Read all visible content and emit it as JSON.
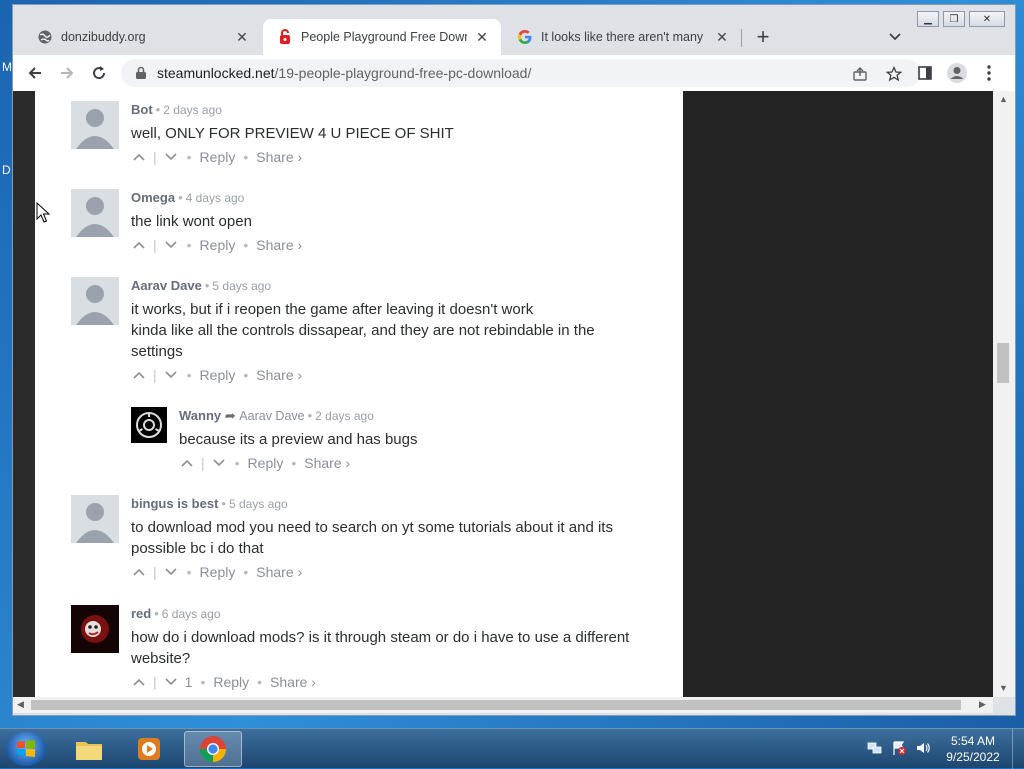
{
  "desktop": {
    "letters": [
      "M",
      "D"
    ]
  },
  "browser": {
    "tabs": [
      {
        "title": "donzibuddy.org",
        "icon": "globe-icon",
        "active": false
      },
      {
        "title": "People Playground Free Download",
        "icon": "steamunlocked-icon",
        "active": true
      },
      {
        "title": "It looks like there aren't many great matches",
        "icon": "google-icon",
        "active": false
      }
    ],
    "address": {
      "host": "steamunlocked.net",
      "path": "/19-people-playground-free-pc-download/"
    },
    "window_controls": [
      "minimize",
      "restore",
      "close"
    ]
  },
  "comments": {
    "action_labels": {
      "reply": "Reply",
      "share": "Share ›"
    },
    "items": [
      {
        "author": "Bot",
        "time": "2 days ago",
        "lines": [
          "well, ONLY FOR PREVIEW 4 U PIECE OF SHIT"
        ],
        "votes": ""
      },
      {
        "author": "Omega",
        "time": "4 days ago",
        "lines": [
          "the link wont open"
        ],
        "votes": ""
      },
      {
        "author": "Aarav Dave",
        "time": "5 days ago",
        "lines": [
          "it works, but if i reopen the game after leaving it doesn't work",
          "kinda like all the controls dissapear, and they are not rebindable in the settings"
        ],
        "votes": ""
      },
      {
        "author": "Wanny",
        "in_reply_to": "Aarav Dave",
        "time": "2 days ago",
        "lines": [
          "because its a preview and has bugs"
        ],
        "votes": ""
      },
      {
        "author": "bingus is best",
        "time": "5 days ago",
        "lines": [
          "to download mod you need to search on yt some tutorials about it and its possible bc i do that"
        ],
        "votes": ""
      },
      {
        "author": "red",
        "time": "6 days ago",
        "lines": [
          "how do i download mods? is it through steam or do i have to use a different website?"
        ],
        "votes": "1"
      }
    ]
  },
  "taskbar": {
    "items": [
      "windows-explorer-icon",
      "media-player-icon",
      "chrome-icon"
    ],
    "clock": {
      "time": "5:54 AM",
      "date": "9/25/2022"
    }
  }
}
